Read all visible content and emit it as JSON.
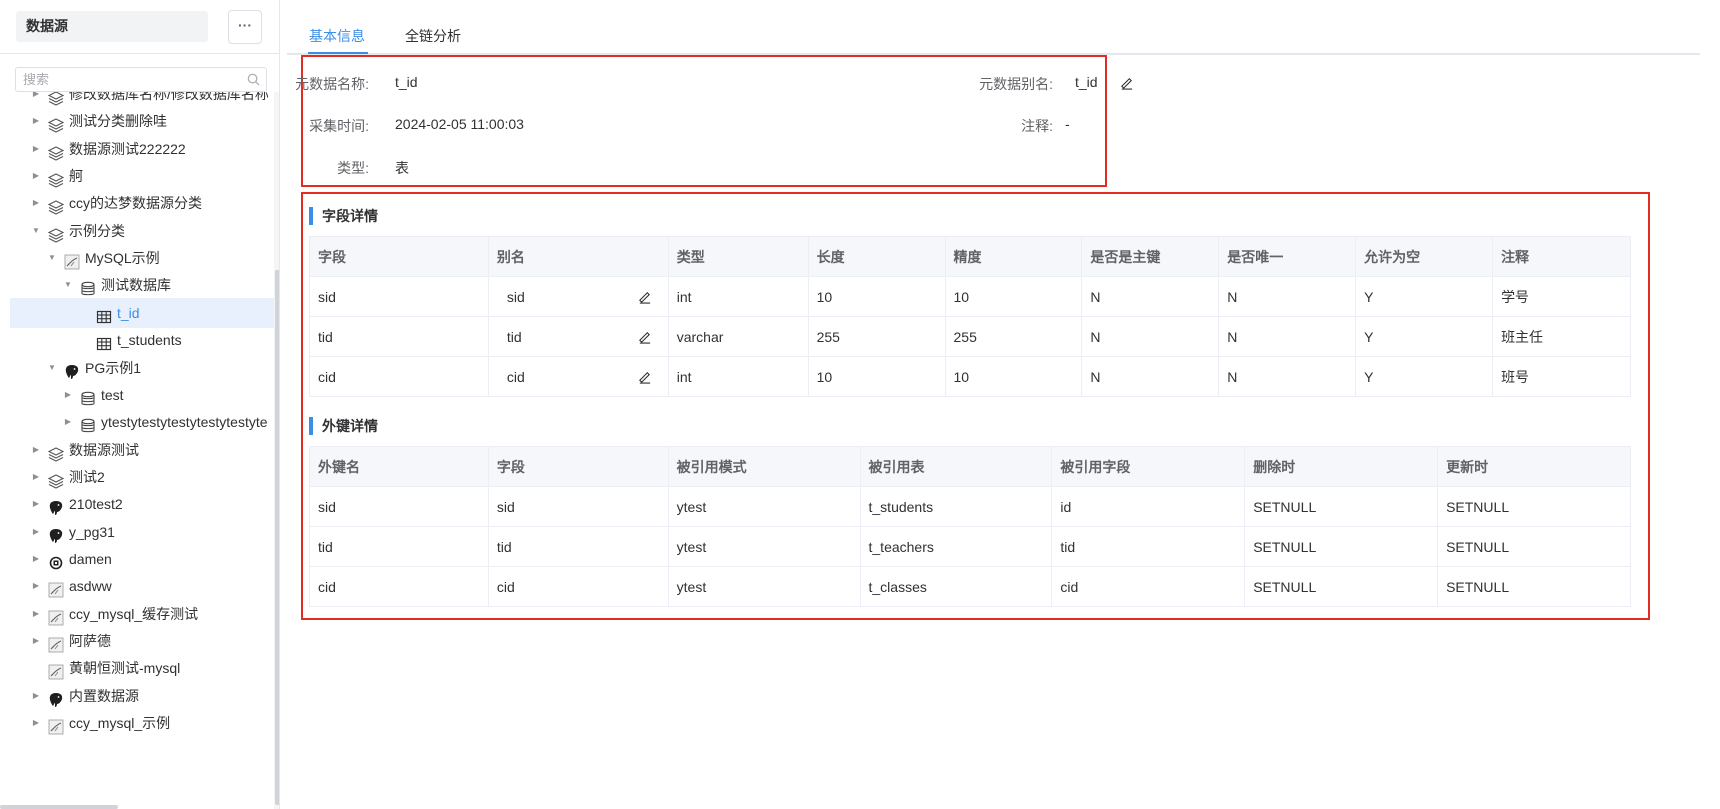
{
  "sidebar": {
    "title": "数据源",
    "more_label": "···",
    "search": {
      "placeholder": "搜索",
      "value": ""
    },
    "tree": [
      {
        "label": "修改数据库名称/修改数据库名称",
        "icon": "layers-icon",
        "depth": 0,
        "caret": "right",
        "selected": false,
        "top": 0
      },
      {
        "label": "测试分类删除哇",
        "icon": "layers-icon",
        "depth": 0,
        "caret": "right",
        "selected": false
      },
      {
        "label": "数据源测试222222",
        "icon": "layers-icon",
        "depth": 0,
        "caret": "right",
        "selected": false
      },
      {
        "label": "舸",
        "icon": "layers-icon",
        "depth": 0,
        "caret": "right",
        "selected": false
      },
      {
        "label": "ccy的达梦数据源分类",
        "icon": "layers-icon",
        "depth": 0,
        "caret": "right",
        "selected": false
      },
      {
        "label": "示例分类",
        "icon": "layers-icon",
        "depth": 0,
        "caret": "down",
        "selected": false
      },
      {
        "label": "MySQL示例",
        "icon": "mysql-icon",
        "depth": 1,
        "caret": "down",
        "selected": false
      },
      {
        "label": "测试数据库",
        "icon": "database-icon",
        "depth": 2,
        "caret": "down",
        "selected": false
      },
      {
        "label": "t_id",
        "icon": "table-icon",
        "depth": 3,
        "caret": "none",
        "selected": true
      },
      {
        "label": "t_students",
        "icon": "table-icon",
        "depth": 3,
        "caret": "none",
        "selected": false
      },
      {
        "label": "PG示例1",
        "icon": "postgresql-icon",
        "depth": 1,
        "caret": "down",
        "selected": false
      },
      {
        "label": "test",
        "icon": "database-icon",
        "depth": 2,
        "caret": "right",
        "selected": false
      },
      {
        "label": "ytestytestytestytestytestyte",
        "icon": "database-icon",
        "depth": 2,
        "caret": "right",
        "selected": false
      },
      {
        "label": "数据源测试",
        "icon": "layers-icon",
        "depth": 0,
        "caret": "right",
        "selected": false
      },
      {
        "label": "测试2",
        "icon": "layers-icon",
        "depth": 0,
        "caret": "right",
        "selected": false
      },
      {
        "label": "210test2",
        "icon": "postgresql-icon",
        "depth": 0,
        "caret": "right",
        "selected": false
      },
      {
        "label": "y_pg31",
        "icon": "postgresql-icon",
        "depth": 0,
        "caret": "right",
        "selected": false
      },
      {
        "label": "damen",
        "icon": "dameng-icon",
        "depth": 0,
        "caret": "right",
        "selected": false
      },
      {
        "label": "asdww",
        "icon": "mysql-icon",
        "depth": 0,
        "caret": "right",
        "selected": false
      },
      {
        "label": "ccy_mysql_缓存测试",
        "icon": "mysql-icon",
        "depth": 0,
        "caret": "right",
        "selected": false
      },
      {
        "label": "阿萨德",
        "icon": "mysql-icon",
        "depth": 0,
        "caret": "right",
        "selected": false
      },
      {
        "label": "黄朝恒测试-mysql",
        "icon": "mysql-icon",
        "depth": 0,
        "caret": "none",
        "selected": false
      },
      {
        "label": "内置数据源",
        "icon": "postgresql-icon",
        "depth": 0,
        "caret": "right",
        "selected": false
      },
      {
        "label": "ccy_mysql_示例",
        "icon": "mysql-icon",
        "depth": 0,
        "caret": "right",
        "selected": false
      }
    ]
  },
  "tabs": [
    {
      "label": "基本信息",
      "active": true
    },
    {
      "label": "全链分析",
      "active": false
    }
  ],
  "basic_info": {
    "name_label": "元数据名称:",
    "name_value": "t_id",
    "alias_label": "元数据别名:",
    "alias_value": "t_id",
    "collect_time_label": "采集时间:",
    "collect_time_value": "2024-02-05 11:00:03",
    "comment_label": "注释:",
    "comment_value": "-",
    "type_label": "类型:",
    "type_value": "表"
  },
  "field_details": {
    "title": "字段详情",
    "columns": [
      "字段",
      "别名",
      "类型",
      "长度",
      "精度",
      "是否是主键",
      "是否唯一",
      "允许为空",
      "注释"
    ],
    "rows": [
      [
        "sid",
        "sid",
        "int",
        "10",
        "10",
        "N",
        "N",
        "Y",
        "学号"
      ],
      [
        "tid",
        "tid",
        "varchar",
        "255",
        "255",
        "N",
        "N",
        "Y",
        "班主任"
      ],
      [
        "cid",
        "cid",
        "int",
        "10",
        "10",
        "N",
        "N",
        "Y",
        "班号"
      ]
    ]
  },
  "foreign_keys": {
    "title": "外键详情",
    "columns": [
      "外键名",
      "字段",
      "被引用模式",
      "被引用表",
      "被引用字段",
      "删除时",
      "更新时"
    ],
    "rows": [
      [
        "sid",
        "sid",
        "ytest",
        "t_students",
        "id",
        "SETNULL",
        "SETNULL"
      ],
      [
        "tid",
        "tid",
        "ytest",
        "t_teachers",
        "tid",
        "SETNULL",
        "SETNULL"
      ],
      [
        "cid",
        "cid",
        "ytest",
        "t_classes",
        "cid",
        "SETNULL",
        "SETNULL"
      ]
    ]
  },
  "colors": {
    "accent": "#3a8ee6",
    "highlight_border": "#e22d22",
    "selected_bg": "#e8f0fe"
  }
}
